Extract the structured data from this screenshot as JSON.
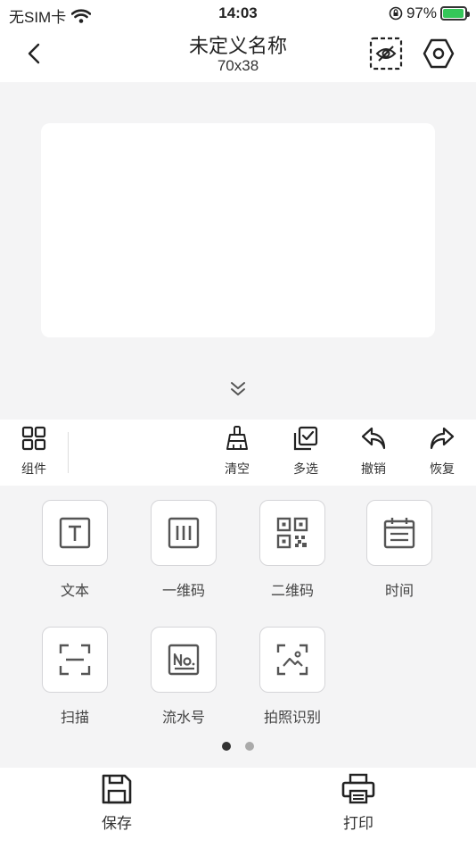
{
  "status_bar": {
    "carrier": "无SIM卡",
    "time": "14:03",
    "battery_text": "97%",
    "battery_level": 0.97
  },
  "header": {
    "title": "未定义名称",
    "size": "70x38"
  },
  "toolbar": {
    "components_label": "组件",
    "clear_label": "清空",
    "multi_select_label": "多选",
    "undo_label": "撤销",
    "redo_label": "恢复"
  },
  "components": [
    {
      "label": "文本",
      "icon": "text-icon"
    },
    {
      "label": "一维码",
      "icon": "barcode-icon"
    },
    {
      "label": "二维码",
      "icon": "qrcode-icon"
    },
    {
      "label": "时间",
      "icon": "calendar-icon"
    },
    {
      "label": "扫描",
      "icon": "scan-icon"
    },
    {
      "label": "流水号",
      "icon": "serial-number-icon"
    },
    {
      "label": "拍照识别",
      "icon": "photo-recognition-icon"
    }
  ],
  "pagination": {
    "current": 1,
    "total": 2
  },
  "bottom_bar": {
    "save_label": "保存",
    "print_label": "打印"
  },
  "colors": {
    "accent_battery": "#34c759",
    "background": "#f4f4f5",
    "surface": "#ffffff"
  }
}
